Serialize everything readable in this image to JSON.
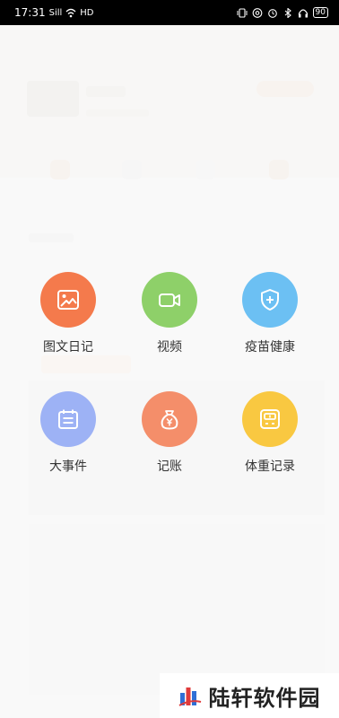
{
  "status_bar": {
    "time": "17:31",
    "signal": "Sill",
    "network": "HD",
    "battery": "90"
  },
  "menu": {
    "items": [
      {
        "label": "图文日记",
        "icon": "image-icon",
        "color": "#f47a4c"
      },
      {
        "label": "视频",
        "icon": "video-camera-icon",
        "color": "#8ed069"
      },
      {
        "label": "疫苗健康",
        "icon": "shield-plus-icon",
        "color": "#6cc0f3"
      },
      {
        "label": "大事件",
        "icon": "calendar-icon",
        "color": "#9db2f5"
      },
      {
        "label": "记账",
        "icon": "money-bag-icon",
        "color": "#f48e6a"
      },
      {
        "label": "体重记录",
        "icon": "scale-icon",
        "color": "#f9c841"
      }
    ]
  },
  "watermark": {
    "text": "陆轩软件园"
  }
}
